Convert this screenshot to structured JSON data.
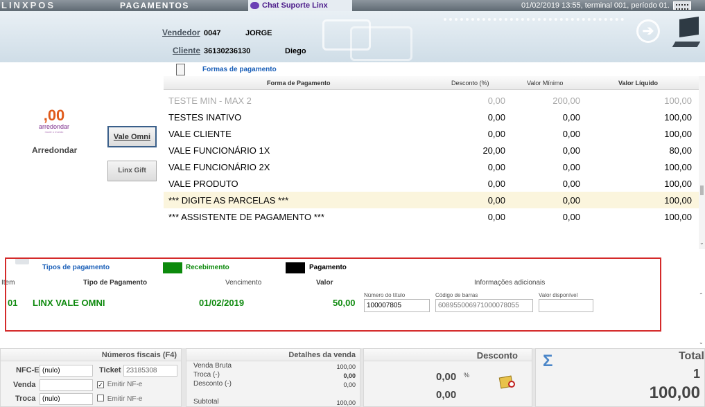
{
  "topbar": {
    "logo": "LINXPOS",
    "screen_title": "PAGAMENTOS",
    "chat_label": "Chat Suporte Linx",
    "status": "01/02/2019 13:55, terminal 001, período 01."
  },
  "header": {
    "vendedor_label": "Vendedor",
    "vendedor_code": "0047",
    "vendedor_name": "JORGE",
    "cliente_label": "Cliente",
    "cliente_code": "36130236130",
    "cliente_name": "Diego"
  },
  "left": {
    "arredondar_logo_top": ",00",
    "arredondar_brand": "arredondar",
    "arredondar_tagline": "mude o mundo",
    "arredondar_label": "Arredondar",
    "vale_omni_button": "Vale Omni",
    "linx_gift_button": "Linx Gift"
  },
  "formas": {
    "title": "Formas de pagamento",
    "columns": [
      "Forma de Pagamento",
      "Desconto (%)",
      "Valor Mínimo",
      "Valor Líquido"
    ],
    "rows": [
      {
        "name": "TESTE MIN - MAX 2",
        "desconto": "0,00",
        "minimo": "200,00",
        "liquido": "100,00",
        "state": "disabled"
      },
      {
        "name": "TESTES INATIVO",
        "desconto": "0,00",
        "minimo": "0,00",
        "liquido": "100,00",
        "state": "normal"
      },
      {
        "name": "VALE CLIENTE",
        "desconto": "0,00",
        "minimo": "0,00",
        "liquido": "100,00",
        "state": "normal"
      },
      {
        "name": "VALE FUNCIONÁRIO 1X",
        "desconto": "20,00",
        "minimo": "0,00",
        "liquido": "80,00",
        "state": "normal"
      },
      {
        "name": "VALE FUNCIONÁRIO 2X",
        "desconto": "0,00",
        "minimo": "0,00",
        "liquido": "100,00",
        "state": "normal"
      },
      {
        "name": "VALE PRODUTO",
        "desconto": "0,00",
        "minimo": "0,00",
        "liquido": "100,00",
        "state": "normal"
      },
      {
        "name": "*** DIGITE AS PARCELAS ***",
        "desconto": "0,00",
        "minimo": "0,00",
        "liquido": "100,00",
        "state": "highlighted"
      },
      {
        "name": "*** ASSISTENTE DE PAGAMENTO ***",
        "desconto": "0,00",
        "minimo": "0,00",
        "liquido": "100,00",
        "state": "normal"
      }
    ]
  },
  "tipos": {
    "title": "Tipos de pagamento",
    "legend_recebimento": "Recebimento",
    "legend_pagamento": "Pagamento",
    "legend_recebimento_color": "#0c8a0c",
    "legend_pagamento_color": "#000000",
    "col_item": "Item",
    "col_tipo": "Tipo de Pagamento",
    "col_vencimento": "Vencimento",
    "col_valor": "Valor",
    "col_info": "Informações adicionais",
    "row": {
      "item": "01",
      "tipo": "LINX VALE OMNI",
      "vencimento": "01/02/2019",
      "valor": "50,00",
      "numero_titulo_label": "Número do título",
      "numero_titulo": "100007805",
      "codigo_barras_label": "Código de barras",
      "codigo_barras": "6089550069710000780­55",
      "valor_disponivel_label": "Valor disponível",
      "valor_disponivel": ""
    }
  },
  "numeros_fiscais": {
    "title": "Números fiscais (F4)",
    "nfce_label": "NFC-E",
    "nfce_value": "(nulo)",
    "ticket_label": "Ticket",
    "ticket_value": "23185308",
    "venda_label": "Venda",
    "venda_value": "",
    "emitir1_label": "Emitir NF-e",
    "emitir1_mark": "✓",
    "troca_label": "Troca",
    "troca_value": "(nulo)",
    "emitir2_label": "Emitir NF-e",
    "emitir2_mark": ""
  },
  "detalhes": {
    "title": "Detalhes da venda",
    "venda_bruta_label": "Venda Bruta",
    "venda_bruta": "100,00",
    "troca_label": "Troca (-)",
    "troca": "0,00",
    "desconto_label": "Desconto (-)",
    "desconto": "0,00",
    "subtotal_label": "Subtotal",
    "subtotal": "100,00"
  },
  "desconto": {
    "title": "Desconto",
    "percent": "0,00",
    "percent_sign": "%",
    "value": "0,00"
  },
  "total": {
    "title": "Total",
    "sigma": "Σ",
    "count": "1",
    "amount": "100,00"
  }
}
